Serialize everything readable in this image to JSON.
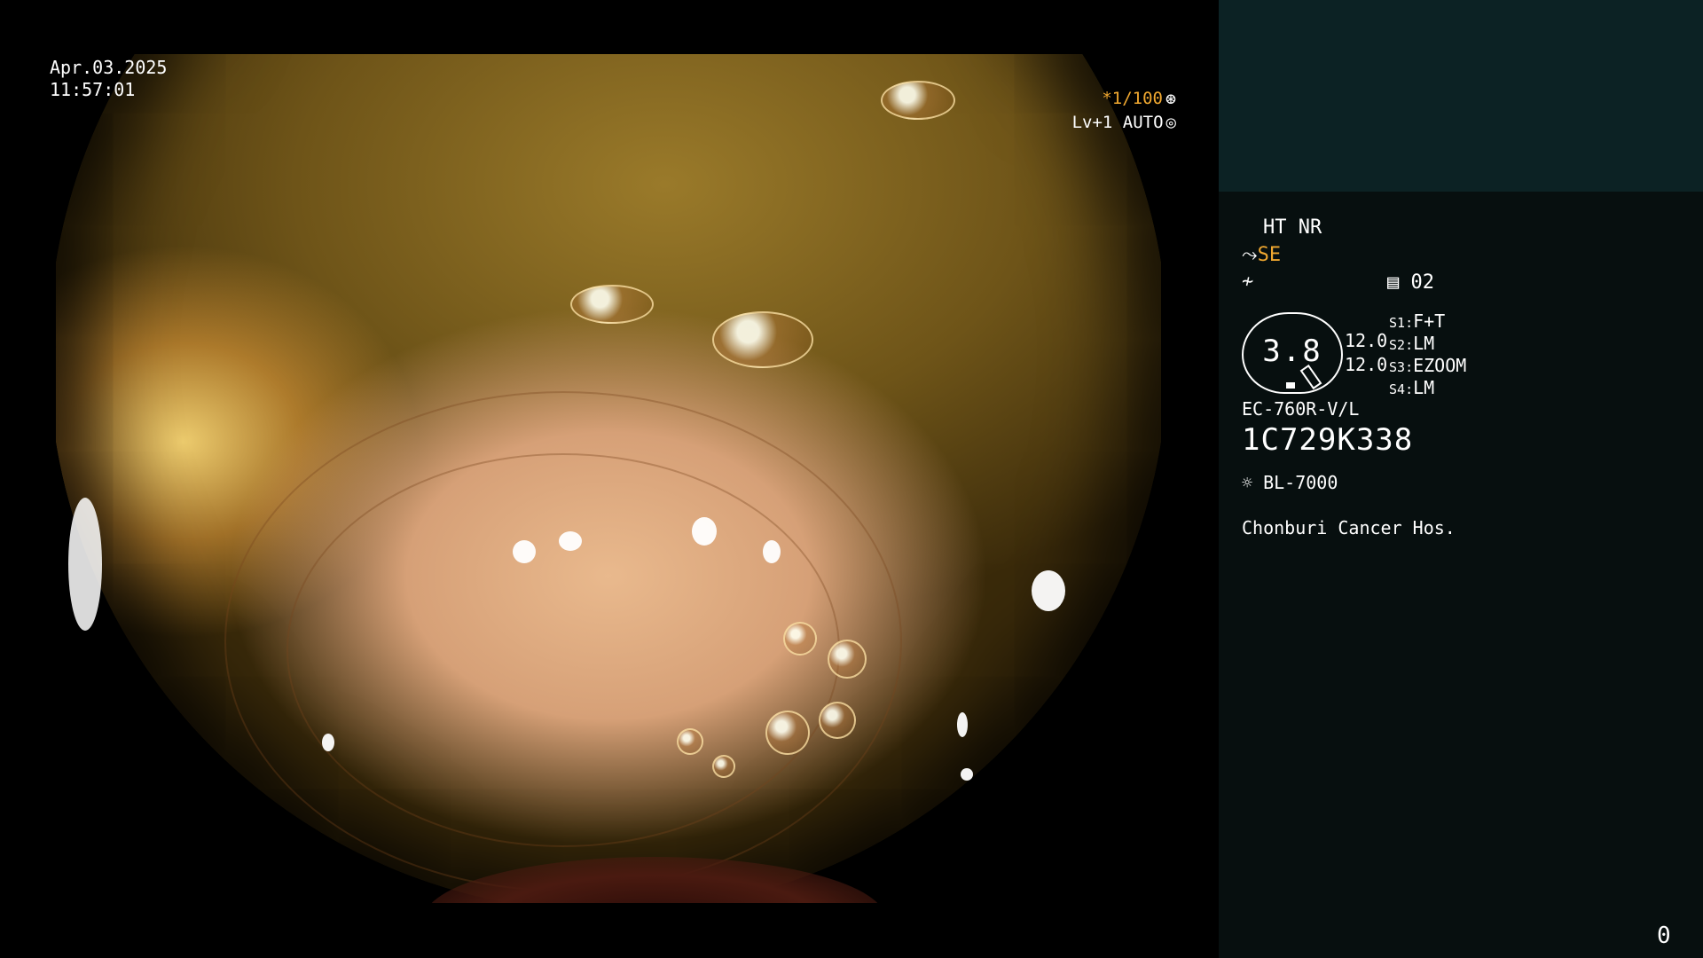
{
  "timestamp": {
    "date": "Apr.03.2025",
    "time": "11:57:01"
  },
  "indicators": {
    "shutter": "*1/100",
    "shutter_icon": "shutter-icon",
    "level": "Lv+1 AUTO",
    "level_icon": "iris-icon"
  },
  "panel": {
    "mode": "HT NR",
    "se_label": "SE",
    "preset_number": "02",
    "dial_value": "3.8",
    "dial_left": "12.0",
    "dial_right": "12.0",
    "settings": [
      {
        "key": "S1",
        "value": "F+T"
      },
      {
        "key": "S2",
        "value": "LM"
      },
      {
        "key": "S3",
        "value": "EZOOM"
      },
      {
        "key": "S4",
        "value": "LM"
      }
    ],
    "scope_model": "EC-760R-V/L",
    "serial": "1C729K338",
    "light_source": "BL-7000",
    "hospital": "Chonburi Cancer Hos."
  },
  "counter": "0",
  "colors": {
    "accent": "#f0a830",
    "panel_top": "#0c2224",
    "panel_bg": "#070f0f"
  }
}
